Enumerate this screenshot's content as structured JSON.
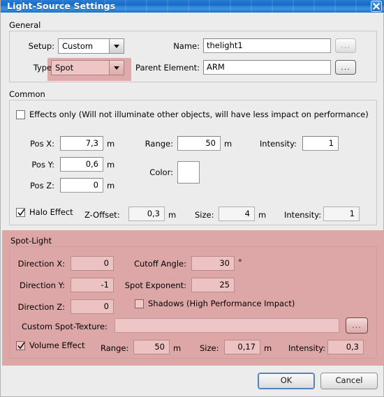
{
  "window": {
    "title": "Light-Source Settings",
    "close_icon": "close-x-icon"
  },
  "general": {
    "legend": "General",
    "setup": {
      "label": "Setup:",
      "value": "Custom",
      "options": [
        "Custom"
      ],
      "arrow_icon": "chevron-down-icon"
    },
    "type": {
      "label": "Type:",
      "value": "Spot",
      "options": [
        "Spot"
      ],
      "arrow_icon": "chevron-down-icon",
      "highlighted": true,
      "highlight_color": "#e0aaaa"
    },
    "name": {
      "label": "Name:",
      "value": "thelight1",
      "placeholder": "",
      "browse_label": "..."
    },
    "parent_element": {
      "label": "Parent Element:",
      "value": "ARM",
      "placeholder": "",
      "browse_label": "..."
    }
  },
  "common": {
    "legend": "Common",
    "effects_only": {
      "label": "Effects only (Will not illuminate other objects, will have less impact on performance)",
      "checked": false
    },
    "pos_x": {
      "label": "Pos X:",
      "value": "7,3",
      "unit": "m"
    },
    "pos_y": {
      "label": "Pos Y:",
      "value": "0,6",
      "unit": "m"
    },
    "pos_z": {
      "label": "Pos Z:",
      "value": "0",
      "unit": "m"
    },
    "range": {
      "label": "Range:",
      "value": "50",
      "unit": "m"
    },
    "intensity": {
      "label": "Intensity:",
      "value": "1"
    },
    "color": {
      "label": "Color:",
      "value": "#ffffff"
    },
    "halo": {
      "label": "Halo Effect",
      "checked": true,
      "z_offset": {
        "label": "Z-Offset:",
        "value": "0,3",
        "unit": "m"
      },
      "size": {
        "label": "Size:",
        "value": "4",
        "unit": "m"
      },
      "intensity": {
        "label": "Intensity:",
        "value": "1"
      }
    }
  },
  "spot_light": {
    "legend": "Spot-Light",
    "highlight_color": "#dea7a7",
    "direction_x": {
      "label": "Direction X:",
      "value": "0"
    },
    "direction_y": {
      "label": "Direction Y:",
      "value": "-1"
    },
    "direction_z": {
      "label": "Direction Z:",
      "value": "0"
    },
    "cutoff_angle": {
      "label": "Cutoff Angle:",
      "value": "30",
      "unit": "°"
    },
    "spot_exponent": {
      "label": "Spot Exponent:",
      "value": "25"
    },
    "shadows": {
      "label": "Shadows (High Performance Impact)",
      "checked": false
    },
    "custom_spot_texture": {
      "label": "Custom Spot-Texture:",
      "value": "",
      "placeholder": "",
      "browse_label": "..."
    },
    "volume": {
      "label": "Volume Effect",
      "checked": true,
      "range": {
        "label": "Range:",
        "value": "50",
        "unit": "m"
      },
      "size": {
        "label": "Size:",
        "value": "0,17",
        "unit": "m"
      },
      "intensity": {
        "label": "Intensity:",
        "value": "0,3"
      }
    }
  },
  "footer": {
    "ok": "OK",
    "cancel": "Cancel"
  }
}
